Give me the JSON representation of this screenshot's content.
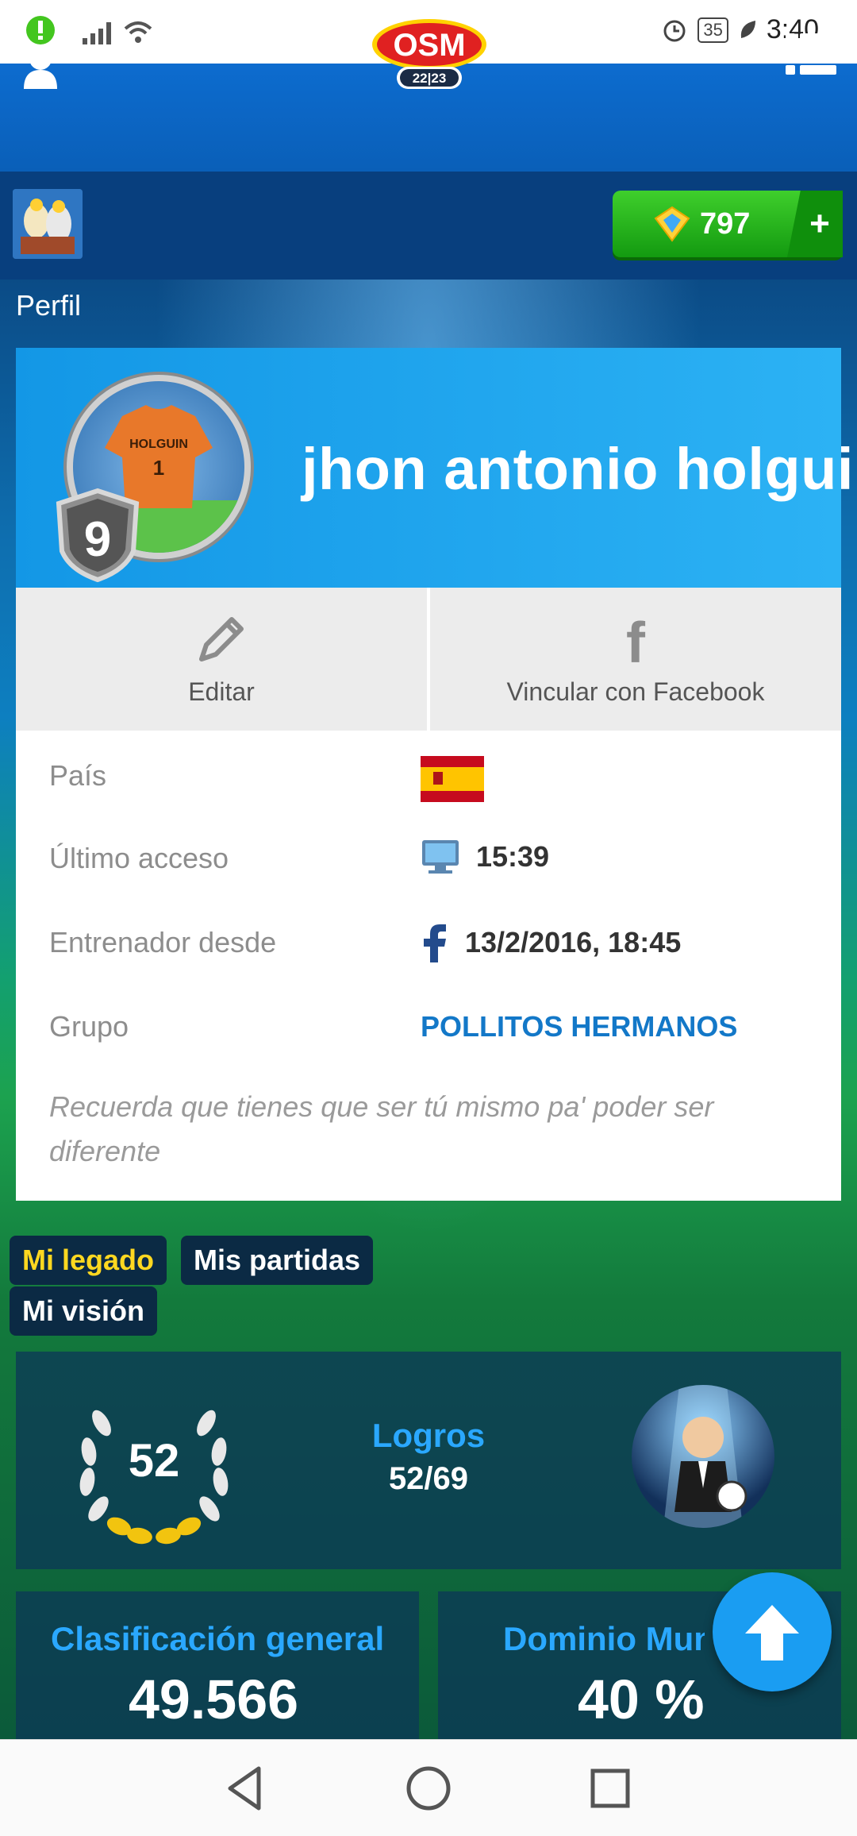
{
  "status_bar": {
    "time": "3:40",
    "battery": "35"
  },
  "header": {
    "logo_text": "OSM",
    "season": "22|23"
  },
  "subbar": {
    "coins": "797",
    "plus": "+"
  },
  "page": {
    "title": "Perfil"
  },
  "profile": {
    "name": "jhon antonio holguin",
    "level": "9",
    "shirt_name": "HOLGUIN",
    "shirt_number": "1",
    "edit_label": "Editar",
    "facebook_label": "Vincular con Facebook",
    "facebook_glyph": "f"
  },
  "info": {
    "country_label": "País",
    "last_access_label": "Último acceso",
    "last_access_value": "15:39",
    "coach_since_label": "Entrenador desde",
    "coach_since_value": "13/2/2016, 18:45",
    "group_label": "Grupo",
    "group_value": "POLLITOS HERMANOS",
    "motto": "Recuerda que tienes que ser tú mismo pa' poder ser diferente"
  },
  "tabs": [
    {
      "label": "Mi legado",
      "active": true
    },
    {
      "label": "Mis partidas",
      "active": false
    },
    {
      "label": "Mi visión",
      "active": false
    }
  ],
  "legacy": {
    "laurel_value": "52",
    "achievements_title": "Logros",
    "achievements_count": "52/69"
  },
  "stats": {
    "general_title": "Clasificación general",
    "general_value": "49.566",
    "domain_title": "Dominio Mundial",
    "domain_value": "40 %"
  },
  "colors": {
    "accent": "#1a9df2",
    "coin_green": "#2cbf1e",
    "active_tab": "#ffd820"
  }
}
